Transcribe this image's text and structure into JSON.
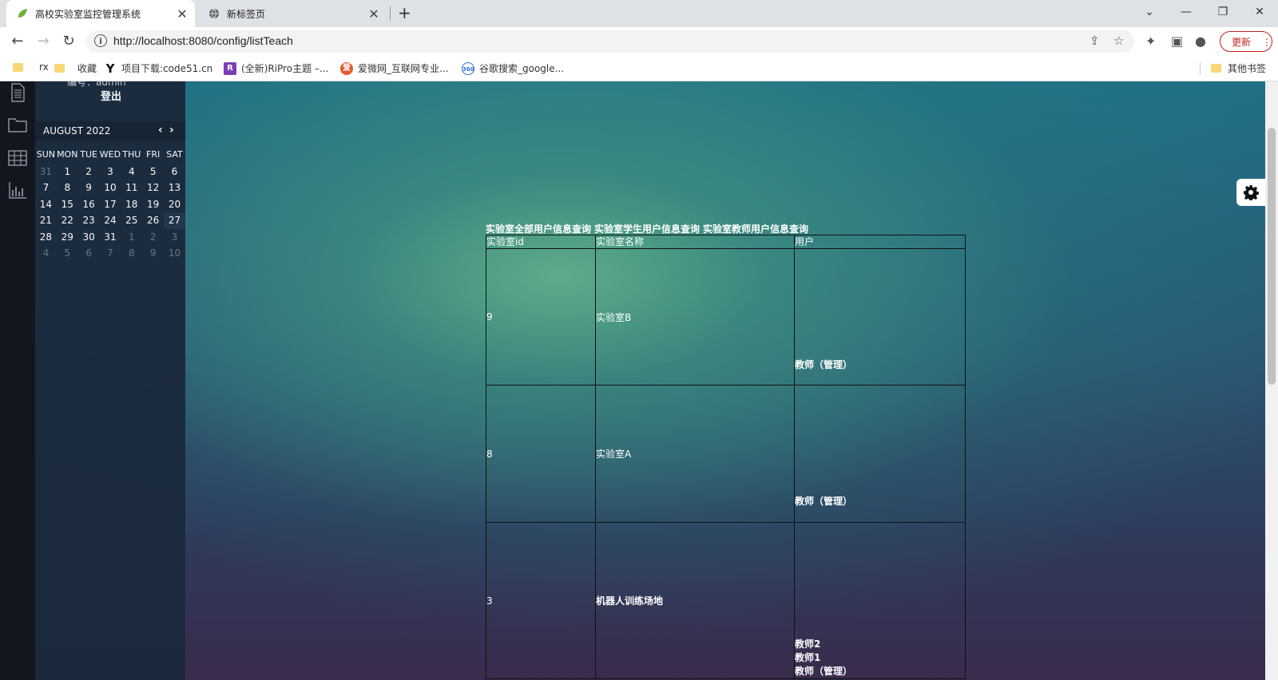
{
  "browser": {
    "tabs": [
      {
        "title": "高校实验室监控管理系统",
        "active": true
      },
      {
        "title": "新标签页",
        "active": false
      }
    ],
    "url": "http://localhost:8080/config/listTeach",
    "update_label": "更新",
    "bookmarks": [
      {
        "label": "rx",
        "icon": "folder-icon"
      },
      {
        "label": "收藏",
        "icon": "folder-icon"
      },
      {
        "label": "项目下载:code51.cn",
        "icon": "y-logo-icon"
      },
      {
        "label": "(全新)RiPro主题 –...",
        "icon": "ripro-icon"
      },
      {
        "label": "爱微网_互联网专业...",
        "icon": "aiwei-icon"
      },
      {
        "label": "谷歌搜索_google...",
        "icon": "360-icon"
      }
    ],
    "other_bookmarks": "其他书签"
  },
  "sidebar": {
    "user_no": "编号：admin",
    "logout": "登出"
  },
  "calendar": {
    "month": "AUGUST 2022",
    "weekdays": [
      "SUN",
      "MON",
      "TUE",
      "WED",
      "THU",
      "FRI",
      "SAT"
    ],
    "weeks": [
      [
        {
          "d": "31",
          "dim": true
        },
        {
          "d": "1"
        },
        {
          "d": "2"
        },
        {
          "d": "3"
        },
        {
          "d": "4"
        },
        {
          "d": "5"
        },
        {
          "d": "6"
        }
      ],
      [
        {
          "d": "7"
        },
        {
          "d": "8"
        },
        {
          "d": "9"
        },
        {
          "d": "10"
        },
        {
          "d": "11"
        },
        {
          "d": "12"
        },
        {
          "d": "13"
        }
      ],
      [
        {
          "d": "14"
        },
        {
          "d": "15"
        },
        {
          "d": "16"
        },
        {
          "d": "17"
        },
        {
          "d": "18"
        },
        {
          "d": "19"
        },
        {
          "d": "20"
        }
      ],
      [
        {
          "d": "21"
        },
        {
          "d": "22"
        },
        {
          "d": "23"
        },
        {
          "d": "24"
        },
        {
          "d": "25"
        },
        {
          "d": "26"
        },
        {
          "d": "27",
          "today": true
        }
      ],
      [
        {
          "d": "28"
        },
        {
          "d": "29"
        },
        {
          "d": "30"
        },
        {
          "d": "31"
        },
        {
          "d": "1",
          "dim": true
        },
        {
          "d": "2",
          "dim": true
        },
        {
          "d": "3",
          "dim": true
        }
      ],
      [
        {
          "d": "4",
          "dim": true
        },
        {
          "d": "5",
          "dim": true
        },
        {
          "d": "6",
          "dim": true
        },
        {
          "d": "7",
          "dim": true
        },
        {
          "d": "8",
          "dim": true
        },
        {
          "d": "9",
          "dim": true
        },
        {
          "d": "10",
          "dim": true
        }
      ]
    ]
  },
  "nav_links": [
    "实验室全部用户信息查询",
    "实验室学生用户信息查询",
    "实验室教师用户信息查询"
  ],
  "table": {
    "headers": [
      "实验室id",
      "实验室名称",
      "用户"
    ],
    "rows": [
      {
        "id": "9",
        "name": "实验室B",
        "users": [
          "教师（管理）"
        ]
      },
      {
        "id": "8",
        "name": "实验室A",
        "users": [
          "教师（管理）"
        ]
      },
      {
        "id": "3",
        "name": "机器人训练场地",
        "users": [
          "教师2",
          "教师1",
          "教师（管理）"
        ]
      }
    ]
  }
}
